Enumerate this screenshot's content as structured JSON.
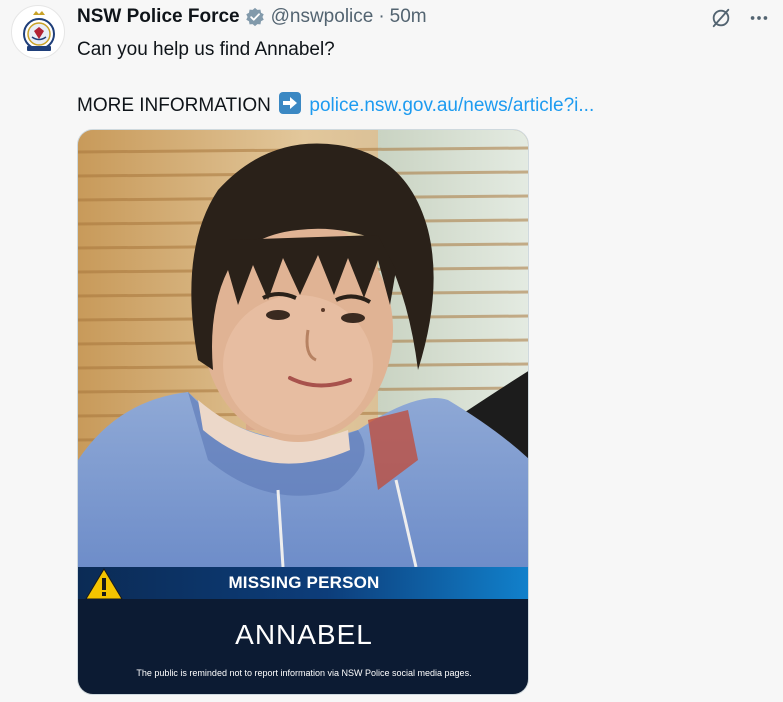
{
  "post": {
    "display_name": "NSW Police Force",
    "handle": "@nswpolice",
    "separator": "·",
    "time": "50m",
    "text_line1": "Can you help us find Annabel?",
    "more_info_label": "MORE INFORMATION",
    "link_text": "police.nsw.gov.au/news/article?i..."
  },
  "media": {
    "banner_title": "MISSING PERSON",
    "person_name": "ANNABEL",
    "disclaimer": "The public is reminded not to report information via NSW Police social media pages."
  },
  "icons": {
    "avatar": "nsw-police-crest-icon",
    "verified": "verified-badge-icon",
    "grok": "grok-icon",
    "more": "more-options-icon",
    "arrow": "right-arrow-emoji-icon",
    "warning": "warning-triangle-icon"
  },
  "colors": {
    "link": "#1d9bf0",
    "muted": "#536471",
    "banner_dark": "#0c1b33",
    "banner_blue": "#1181cc",
    "warning_yellow": "#f5c400"
  }
}
